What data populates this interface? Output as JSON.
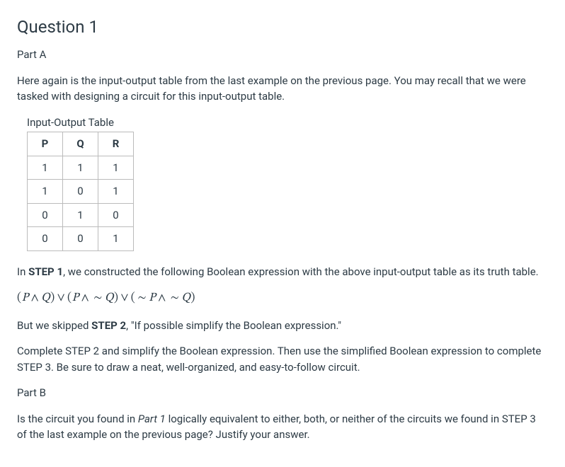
{
  "title": "Question 1",
  "partA": {
    "heading": "Part A",
    "intro": "Here again is the input-output table from the last example on the previous page. You may recall that we were tasked with designing a circuit for this input-output table.",
    "tableCaption": "Input-Output Table",
    "table": {
      "headers": [
        "P",
        "Q",
        "R"
      ],
      "rows": [
        [
          "1",
          "1",
          "1"
        ],
        [
          "1",
          "0",
          "1"
        ],
        [
          "0",
          "1",
          "0"
        ],
        [
          "0",
          "0",
          "1"
        ]
      ]
    },
    "step1_prefix": "In ",
    "step1_bold": "STEP 1",
    "step1_suffix": ", we constructed the following Boolean expression with the above input-output table as its truth table.",
    "expression": "(P ∧ Q) ∨ (P∧ ∼ Q) ∨ (∼ P∧ ∼ Q)",
    "step2_prefix": "But we skipped ",
    "step2_bold": "STEP 2",
    "step2_suffix": ", \"If possible simplify the Boolean expression.\"",
    "instruction": "Complete STEP 2 and simplify the Boolean expression. Then use the simplified Boolean expression to complete STEP 3. Be sure to draw a neat, well-organized, and easy-to-follow circuit."
  },
  "partB": {
    "heading": "Part B",
    "text_prefix": "Is the circuit you found in ",
    "text_em": "Part 1",
    "text_suffix": " logically equivalent to either, both, or neither of the circuits we found in STEP 3 of the last example on the previous page? Justify your answer."
  }
}
